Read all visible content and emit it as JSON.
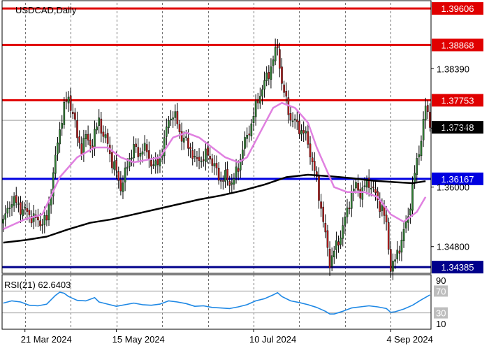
{
  "symbol_label": "USDCAD,Daily",
  "rsi_label": "RSI(21) 62.6403",
  "colors": {
    "frame": "#000000",
    "grid": "#000000",
    "candle_up": "#2e7d32",
    "candle_down": "#b71c1c",
    "resistance": "#e00000",
    "support_mid": "#0000e0",
    "support_low": "#00008b",
    "ma_fast": "#e080e0",
    "ma_slow": "#000000",
    "rsi_line": "#1e88e5",
    "current_price_bg": "#000000"
  },
  "chart_data": [
    {
      "type": "candlestick",
      "title": "USDCAD,Daily",
      "x_tick_labels": [
        "21 Mar 2024",
        "15 May 2024",
        "10 Jul 2024",
        "4 Sep 2024"
      ],
      "y_tick_labels": [
        "1.38390",
        "1.37190",
        "1.36000",
        "1.34800"
      ],
      "ylim": [
        1.3426,
        1.3972
      ],
      "current_price": "1.37348",
      "levels": [
        {
          "value": 1.39606,
          "label": "1.39606",
          "kind": "resistance"
        },
        {
          "value": 1.38868,
          "label": "1.38868",
          "kind": "resistance"
        },
        {
          "value": 1.37753,
          "label": "1.37753",
          "kind": "resistance"
        },
        {
          "value": 1.36167,
          "label": "1.36167",
          "kind": "support_mid"
        },
        {
          "value": 1.34385,
          "label": "1.34385",
          "kind": "support_low"
        }
      ],
      "close_path": [
        [
          0,
          1.353
        ],
        [
          4,
          1.3575
        ],
        [
          8,
          1.3558
        ],
        [
          12,
          1.3545
        ],
        [
          16,
          1.353
        ],
        [
          20,
          1.3532
        ],
        [
          23,
          1.3625
        ],
        [
          26,
          1.372
        ],
        [
          28,
          1.376
        ],
        [
          30,
          1.378
        ],
        [
          32,
          1.375
        ],
        [
          34,
          1.37
        ],
        [
          36,
          1.368
        ],
        [
          38,
          1.37
        ],
        [
          41,
          1.3685
        ],
        [
          44,
          1.374
        ],
        [
          46,
          1.37
        ],
        [
          48,
          1.369
        ],
        [
          50,
          1.365
        ],
        [
          52,
          1.363
        ],
        [
          54,
          1.36
        ],
        [
          56,
          1.3625
        ],
        [
          58,
          1.366
        ],
        [
          60,
          1.368
        ],
        [
          62,
          1.3665
        ],
        [
          64,
          1.368
        ],
        [
          66,
          1.367
        ],
        [
          68,
          1.365
        ],
        [
          70,
          1.364
        ],
        [
          72,
          1.366
        ],
        [
          74,
          1.369
        ],
        [
          76,
          1.374
        ],
        [
          78,
          1.3745
        ],
        [
          80,
          1.373
        ],
        [
          82,
          1.37
        ],
        [
          84,
          1.369
        ],
        [
          86,
          1.368
        ],
        [
          88,
          1.365
        ],
        [
          90,
          1.366
        ],
        [
          92,
          1.3655
        ],
        [
          94,
          1.367
        ],
        [
          96,
          1.365
        ],
        [
          98,
          1.363
        ],
        [
          100,
          1.3615
        ],
        [
          102,
          1.362
        ],
        [
          104,
          1.361
        ],
        [
          106,
          1.3615
        ],
        [
          108,
          1.364
        ],
        [
          110,
          1.368
        ],
        [
          112,
          1.37
        ],
        [
          114,
          1.373
        ],
        [
          116,
          1.376
        ],
        [
          118,
          1.379
        ],
        [
          120,
          1.381
        ],
        [
          122,
          1.383
        ],
        [
          124,
          1.386
        ],
        [
          126,
          1.388
        ],
        [
          127,
          1.385
        ],
        [
          128,
          1.381
        ],
        [
          130,
          1.377
        ],
        [
          132,
          1.374
        ],
        [
          134,
          1.373
        ],
        [
          136,
          1.372
        ],
        [
          138,
          1.371
        ],
        [
          140,
          1.369
        ],
        [
          142,
          1.365
        ],
        [
          144,
          1.361
        ],
        [
          146,
          1.356
        ],
        [
          148,
          1.35
        ],
        [
          150,
          1.345
        ],
        [
          152,
          1.347
        ],
        [
          154,
          1.349
        ],
        [
          156,
          1.352
        ],
        [
          158,
          1.355
        ],
        [
          160,
          1.359
        ],
        [
          162,
          1.36
        ],
        [
          164,
          1.359
        ],
        [
          166,
          1.36
        ],
        [
          168,
          1.361
        ],
        [
          170,
          1.3595
        ],
        [
          172,
          1.357
        ],
        [
          174,
          1.356
        ],
        [
          176,
          1.352
        ],
        [
          178,
          1.344
        ],
        [
          180,
          1.345
        ],
        [
          182,
          1.348
        ],
        [
          184,
          1.351
        ],
        [
          186,
          1.354
        ],
        [
          188,
          1.36
        ],
        [
          190,
          1.365
        ],
        [
          192,
          1.37
        ],
        [
          194,
          1.376
        ],
        [
          196,
          1.3735
        ]
      ],
      "ma_fast_path": [
        [
          0,
          1.3515
        ],
        [
          10,
          1.3535
        ],
        [
          18,
          1.3545
        ],
        [
          26,
          1.362
        ],
        [
          34,
          1.366
        ],
        [
          42,
          1.368
        ],
        [
          48,
          1.368
        ],
        [
          54,
          1.366
        ],
        [
          60,
          1.365
        ],
        [
          66,
          1.3655
        ],
        [
          72,
          1.366
        ],
        [
          78,
          1.37
        ],
        [
          84,
          1.371
        ],
        [
          90,
          1.37
        ],
        [
          96,
          1.368
        ],
        [
          102,
          1.366
        ],
        [
          108,
          1.365
        ],
        [
          112,
          1.366
        ],
        [
          118,
          1.371
        ],
        [
          124,
          1.376
        ],
        [
          128,
          1.377
        ],
        [
          134,
          1.376
        ],
        [
          140,
          1.373
        ],
        [
          144,
          1.368
        ],
        [
          148,
          1.364
        ],
        [
          152,
          1.36
        ],
        [
          158,
          1.359
        ],
        [
          166,
          1.359
        ],
        [
          172,
          1.358
        ],
        [
          178,
          1.3545
        ],
        [
          184,
          1.353
        ],
        [
          190,
          1.355
        ],
        [
          194,
          1.358
        ]
      ],
      "ma_slow_path": [
        [
          0,
          1.3488
        ],
        [
          10,
          1.3493
        ],
        [
          20,
          1.35
        ],
        [
          30,
          1.3515
        ],
        [
          40,
          1.3528
        ],
        [
          50,
          1.3535
        ],
        [
          60,
          1.3545
        ],
        [
          70,
          1.3555
        ],
        [
          80,
          1.3565
        ],
        [
          90,
          1.3575
        ],
        [
          100,
          1.3583
        ],
        [
          110,
          1.3593
        ],
        [
          120,
          1.3605
        ],
        [
          130,
          1.362
        ],
        [
          140,
          1.3625
        ],
        [
          150,
          1.3622
        ],
        [
          160,
          1.3618
        ],
        [
          170,
          1.3613
        ],
        [
          180,
          1.361
        ],
        [
          188,
          1.3608
        ],
        [
          194,
          1.3612
        ]
      ],
      "rsi": {
        "label": "RSI(21) 62.6403",
        "ylim": [
          0,
          100
        ],
        "tick_labels": [
          "90",
          "70",
          "30",
          "10"
        ],
        "ticks": [
          90,
          70,
          30,
          10
        ],
        "levels": [
          70,
          30
        ],
        "path": [
          [
            0,
            48
          ],
          [
            4,
            52
          ],
          [
            8,
            50
          ],
          [
            12,
            44
          ],
          [
            16,
            43
          ],
          [
            20,
            46
          ],
          [
            24,
            62
          ],
          [
            26,
            68
          ],
          [
            28,
            66
          ],
          [
            30,
            60
          ],
          [
            34,
            53
          ],
          [
            38,
            52
          ],
          [
            42,
            58
          ],
          [
            44,
            50
          ],
          [
            48,
            46
          ],
          [
            52,
            42
          ],
          [
            56,
            45
          ],
          [
            60,
            48
          ],
          [
            64,
            45
          ],
          [
            68,
            44
          ],
          [
            72,
            46
          ],
          [
            76,
            52
          ],
          [
            80,
            50
          ],
          [
            84,
            47
          ],
          [
            88,
            42
          ],
          [
            92,
            43
          ],
          [
            96,
            40
          ],
          [
            100,
            39
          ],
          [
            104,
            38
          ],
          [
            108,
            41
          ],
          [
            112,
            45
          ],
          [
            116,
            52
          ],
          [
            120,
            56
          ],
          [
            124,
            63
          ],
          [
            126,
            67
          ],
          [
            128,
            60
          ],
          [
            132,
            52
          ],
          [
            136,
            49
          ],
          [
            140,
            45
          ],
          [
            144,
            40
          ],
          [
            148,
            33
          ],
          [
            150,
            28
          ],
          [
            152,
            28
          ],
          [
            156,
            33
          ],
          [
            160,
            39
          ],
          [
            164,
            41
          ],
          [
            168,
            43
          ],
          [
            172,
            41
          ],
          [
            176,
            38
          ],
          [
            178,
            31
          ],
          [
            180,
            32
          ],
          [
            184,
            37
          ],
          [
            188,
            44
          ],
          [
            192,
            54
          ],
          [
            196,
            63
          ]
        ]
      }
    }
  ]
}
